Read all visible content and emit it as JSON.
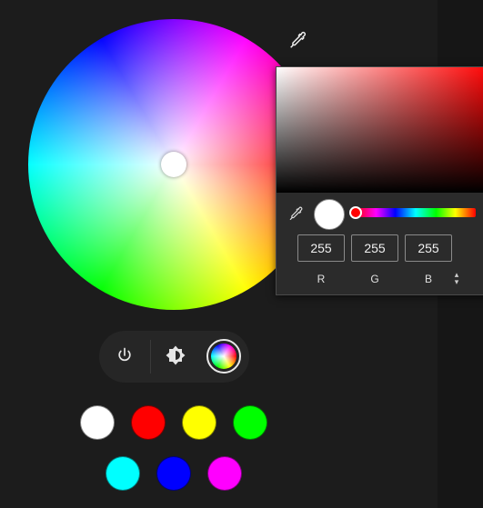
{
  "wheel": {
    "selected_color": "#ffffff"
  },
  "picker": {
    "hue_color": "#ff0000",
    "preview_color": "#ffffff",
    "rgb": {
      "r": "255",
      "g": "255",
      "b": "255"
    },
    "labels": {
      "r": "R",
      "g": "G",
      "b": "B"
    },
    "mode_toggle_glyph": "▴▾"
  },
  "modes": {
    "power": "power-icon",
    "brightness": "brightness-icon",
    "color": "color-wheel-icon"
  },
  "presets": [
    {
      "name": "white",
      "color": "#ffffff"
    },
    {
      "name": "red",
      "color": "#ff0000"
    },
    {
      "name": "yellow",
      "color": "#ffff00"
    },
    {
      "name": "green",
      "color": "#00ff00"
    },
    {
      "name": "cyan",
      "color": "#00ffff"
    },
    {
      "name": "blue",
      "color": "#0000ff"
    },
    {
      "name": "magenta",
      "color": "#ff00ff"
    }
  ]
}
